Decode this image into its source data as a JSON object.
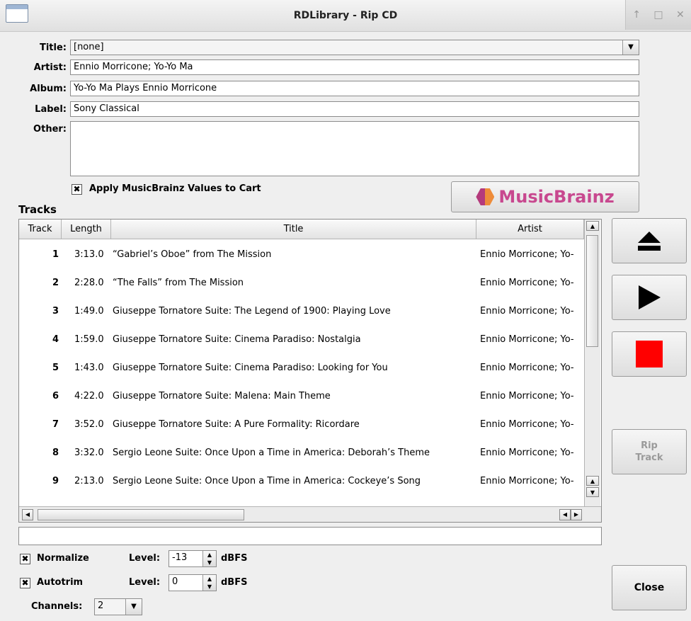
{
  "window": {
    "title": "RDLibrary - Rip CD",
    "controls": [
      "↑",
      "□",
      "✕"
    ]
  },
  "form": {
    "title_label": "Title:",
    "title_value": "[none]",
    "artist_label": "Artist:",
    "artist_value": "Ennio Morricone; Yo-Yo Ma",
    "album_label": "Album:",
    "album_value": "Yo-Yo Ma Plays Ennio Morricone",
    "label_label": "Label:",
    "label_value": "Sony Classical",
    "other_label": "Other:",
    "other_value": "",
    "apply_checked": true,
    "apply_label": "Apply MusicBrainz Values to Cart",
    "musicbrainz_label": "MusicBrainz"
  },
  "tracks": {
    "heading": "Tracks",
    "columns": [
      "Track",
      "Length",
      "Title",
      "Artist"
    ],
    "rows": [
      {
        "num": "1",
        "length": "3:13.0",
        "title": "“Gabriel’s Oboe” from The Mission",
        "artist": "Ennio Morricone; Yo-"
      },
      {
        "num": "2",
        "length": "2:28.0",
        "title": "“The Falls” from The Mission",
        "artist": "Ennio Morricone; Yo-"
      },
      {
        "num": "3",
        "length": "1:49.0",
        "title": "Giuseppe Tornatore Suite: The Legend of 1900: Playing Love",
        "artist": "Ennio Morricone; Yo-"
      },
      {
        "num": "4",
        "length": "1:59.0",
        "title": "Giuseppe Tornatore Suite: Cinema Paradiso: Nostalgia",
        "artist": "Ennio Morricone; Yo-"
      },
      {
        "num": "5",
        "length": "1:43.0",
        "title": "Giuseppe Tornatore Suite: Cinema Paradiso: Looking for You",
        "artist": "Ennio Morricone; Yo-"
      },
      {
        "num": "6",
        "length": "4:22.0",
        "title": "Giuseppe Tornatore Suite: Malena: Main Theme",
        "artist": "Ennio Morricone; Yo-"
      },
      {
        "num": "7",
        "length": "3:52.0",
        "title": "Giuseppe Tornatore Suite: A Pure Formality: Ricordare",
        "artist": "Ennio Morricone; Yo-"
      },
      {
        "num": "8",
        "length": "3:32.0",
        "title": "Sergio Leone Suite: Once Upon a Time in America: Deborah’s Theme",
        "artist": "Ennio Morricone; Yo-"
      },
      {
        "num": "9",
        "length": "2:13.0",
        "title": "Sergio Leone Suite: Once Upon a Time in America: Cockeye’s Song",
        "artist": "Ennio Morricone; Yo-"
      }
    ]
  },
  "status_text": "",
  "controls": {
    "rip_track_label": "Rip\nTrack",
    "close_label": "Close",
    "normalize_checked": true,
    "normalize_label": "Normalize",
    "normalize_level_label": "Level:",
    "normalize_level": "-13",
    "normalize_unit": "dBFS",
    "autotrim_checked": true,
    "autotrim_label": "Autotrim",
    "autotrim_level_label": "Level:",
    "autotrim_level": "0",
    "autotrim_unit": "dBFS",
    "channels_label": "Channels:",
    "channels_value": "2"
  },
  "colors": {
    "stop_red": "#ff0000",
    "musicbrainz_purple": "#c8488f",
    "musicbrainz_orange": "#ee8c3a"
  }
}
